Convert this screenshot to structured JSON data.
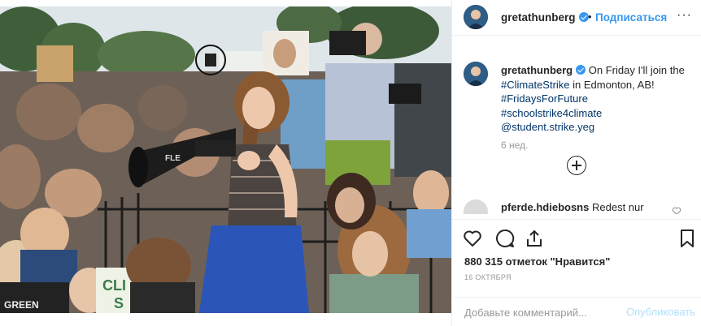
{
  "header": {
    "username": "gretathunberg",
    "separator": "•",
    "follow_label": "Подписаться",
    "more_label": "···"
  },
  "caption": {
    "username": "gretathunberg",
    "text": "On Friday I'll join the",
    "hashtag_climate": "#ClimateStrike",
    "text_after": "in Edmonton, AB!",
    "hashtag_fridays": "#FridaysForFuture",
    "hashtag_school": "#schoolstrike4climate",
    "mention": "@student.strike.yeg",
    "time": "6 нед."
  },
  "comments": [
    {
      "username": "pferde.hdiebosns",
      "text": "Redest nur"
    }
  ],
  "photo": {
    "sign_text": "CLI",
    "sign_text2": "S",
    "shirt_text": "GREEN",
    "megaphone_text": "FLE"
  },
  "actions": {
    "likes": "880 315 отметок \"Нравится\"",
    "date": "16 ОКТЯБРЯ"
  },
  "add_comment": {
    "placeholder": "Добавьте комментарий...",
    "publish_label": "Опубликовать"
  },
  "colors": {
    "link": "#3897f0",
    "hashtag": "#003569",
    "muted": "#999999",
    "publish_disabled": "#b2dffc"
  }
}
